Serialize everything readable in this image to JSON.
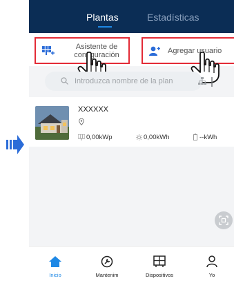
{
  "tabs": {
    "plantas": "Plantas",
    "estadisticas": "Estadísticas"
  },
  "actions": {
    "asistente": "Asistente de configuración",
    "agregar": "Agregar usuario"
  },
  "search": {
    "placeholder": "Introduzca nombre de la plan"
  },
  "plant": {
    "name": "XXXXXX",
    "power": "0,00kWp",
    "energy": "0,00kWh",
    "kwh": "--kWh"
  },
  "bottom_nav": {
    "inicio": "Inicio",
    "mantenim": "Mantenim",
    "dispositivos": "Dispositivos",
    "yo": "Yo"
  },
  "colors": {
    "header_bg": "#0b2d55",
    "accent": "#1e88e5",
    "highlight_border": "#e32a36",
    "arrow": "#2b6cd8"
  }
}
